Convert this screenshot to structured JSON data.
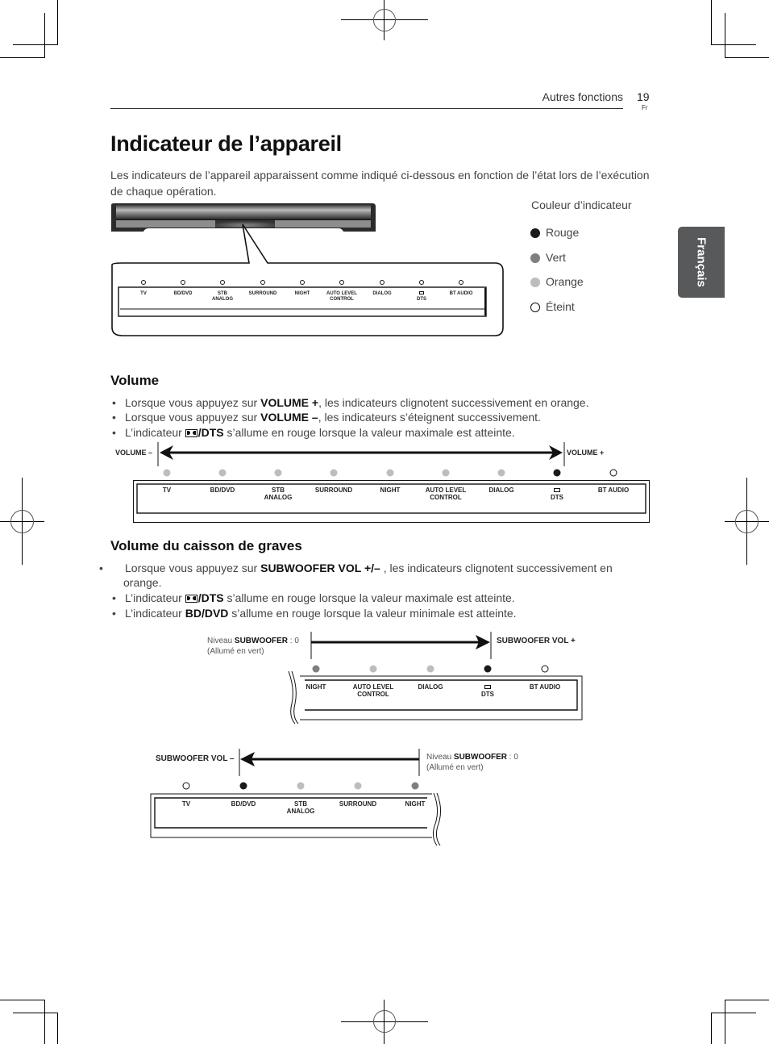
{
  "header": {
    "section": "Autres fonctions",
    "page_number": "19",
    "language_code": "Fr"
  },
  "language_tab": "Français",
  "title": "Indicateur de l’appareil",
  "intro": "Les indicateurs de l’appareil apparaissent comme indiqué ci-dessous en fonction de l’état lors de l’exécution de chaque opération.",
  "legend": {
    "title": "Couleur d’indicateur",
    "items": [
      {
        "label": "Rouge",
        "color": "#1a1a1a",
        "style": "filled"
      },
      {
        "label": "Vert",
        "color": "#7f7f7f",
        "style": "filled"
      },
      {
        "label": "Orange",
        "color": "#bdbdbd",
        "style": "filled"
      },
      {
        "label": "Éteint",
        "color": "#ffffff",
        "style": "outline"
      }
    ]
  },
  "indicators": [
    {
      "line1": "TV",
      "line2": ""
    },
    {
      "line1": "BD/DVD",
      "line2": ""
    },
    {
      "line1": "STB",
      "line2": "ANALOG"
    },
    {
      "line1": "SURROUND",
      "line2": ""
    },
    {
      "line1": "NIGHT",
      "line2": ""
    },
    {
      "line1": "AUTO LEVEL",
      "line2": "CONTROL"
    },
    {
      "line1": "DIALOG",
      "line2": ""
    },
    {
      "line1": "",
      "line2": "DTS",
      "dolby_icon": true
    },
    {
      "line1": "BT AUDIO",
      "line2": ""
    }
  ],
  "volume": {
    "heading": "Volume",
    "bullets": [
      {
        "pre": "Lorsque vous appuyez sur ",
        "bold": "VOLUME +",
        "post": ", les indicateurs clignotent successivement en orange."
      },
      {
        "pre": "Lorsque vous appuyez sur ",
        "bold": "VOLUME –",
        "post": ", les indicateurs s’éteignent successivement."
      },
      {
        "pre": "L’indicateur ",
        "bold": "/DTS",
        "post": " s’allume en rouge lorsque la valeur maximale est atteinte.",
        "dolby_icon": true
      }
    ],
    "diagram": {
      "left_label": "VOLUME –",
      "right_label": "VOLUME +",
      "led_states": [
        "orange",
        "orange",
        "orange",
        "orange",
        "orange",
        "orange",
        "orange",
        "rouge",
        "eteint"
      ]
    }
  },
  "subwoofer": {
    "heading": "Volume du caisson de graves",
    "bullets": [
      {
        "pre": "Lorsque vous appuyez sur ",
        "bold": "SUBWOOFER VOL +/–",
        "post": " , les indicateurs clignotent successivement en orange."
      },
      {
        "pre": "L’indicateur ",
        "bold": "/DTS",
        "post": " s’allume en rouge lorsque la valeur maximale est atteinte.",
        "dolby_icon": true
      },
      {
        "pre": "L’indicateur ",
        "bold": "BD/DVD",
        "post": " s’allume en rouge lorsque la valeur minimale est atteinte."
      }
    ],
    "diagram_up": {
      "arrow_label": "SUBWOOFER VOL +",
      "note_pre": "Niveau ",
      "note_bold": "SUBWOOFER",
      "note_post": " : 0",
      "note_line2": "(Allumé en vert)",
      "labels": [
        {
          "line1": "NIGHT",
          "line2": ""
        },
        {
          "line1": "AUTO LEVEL",
          "line2": "CONTROL"
        },
        {
          "line1": "DIALOG",
          "line2": ""
        },
        {
          "line1": "",
          "line2": "DTS",
          "dolby_icon": true
        },
        {
          "line1": "BT AUDIO",
          "line2": ""
        }
      ],
      "led_states": [
        "vert",
        "orange",
        "orange",
        "rouge",
        "eteint"
      ]
    },
    "diagram_down": {
      "arrow_label": "SUBWOOFER VOL –",
      "note_pre": "Niveau ",
      "note_bold": "SUBWOOFER",
      "note_post": " : 0",
      "note_line2": "(Allumé en vert)",
      "labels": [
        {
          "line1": "TV",
          "line2": ""
        },
        {
          "line1": "BD/DVD",
          "line2": ""
        },
        {
          "line1": "STB",
          "line2": "ANALOG"
        },
        {
          "line1": "SURROUND",
          "line2": ""
        },
        {
          "line1": "NIGHT",
          "line2": ""
        }
      ],
      "led_states": [
        "eteint",
        "rouge",
        "orange",
        "orange",
        "vert"
      ]
    }
  },
  "led_colors": {
    "rouge": "#1a1a1a",
    "vert": "#7f7f7f",
    "orange": "#bdbdbd",
    "eteint": "#ffffff"
  }
}
